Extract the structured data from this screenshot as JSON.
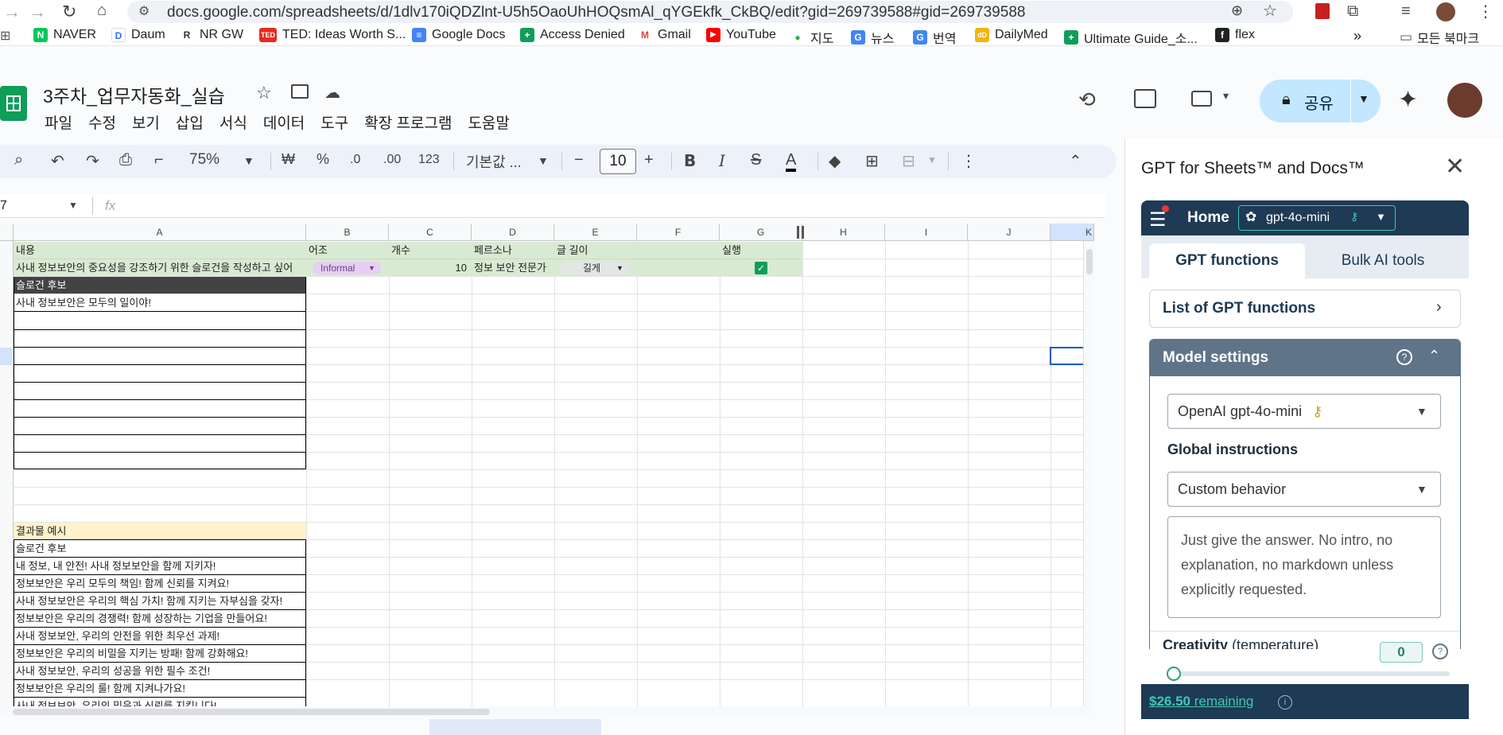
{
  "browser": {
    "url": "docs.google.com/spreadsheets/d/1dlv170iQDZlnt-U5h5OaoUhHOQsmAl_qYGEkfk_CkBQ/edit?gid=269739588#gid=269739588",
    "bookmarks": [
      "NAVER",
      "Daum",
      "NR GW",
      "TED: Ideas Worth S...",
      "Google Docs",
      "Access Denied",
      "Gmail",
      "YouTube",
      "지도",
      "뉴스",
      "번역",
      "DailyMed",
      "Ultimate Guide_소...",
      "flex"
    ],
    "all_bookmarks": "모든 북마크",
    "bookmark_overflow": "»"
  },
  "sheet": {
    "title": "3주차_업무자동화_실습",
    "menu": [
      "파일",
      "수정",
      "보기",
      "삽입",
      "서식",
      "데이터",
      "도구",
      "확장 프로그램",
      "도움말"
    ],
    "share_label": "공유",
    "toolbar": {
      "zoom": "75%",
      "currency": "₩",
      "percent": "%",
      "dec_minus": ".0",
      "dec_plus": ".00",
      "num_format": "123",
      "font": "기본값 ...",
      "font_size": "10",
      "bold": "B",
      "italic": "I",
      "text_color": "A"
    },
    "name_box": "7",
    "fx": "fx",
    "columns": [
      "A",
      "B",
      "C",
      "D",
      "E",
      "F",
      "G",
      "H",
      "I",
      "J",
      "K"
    ],
    "header_row": {
      "a": "내용",
      "b": "어조",
      "c": "개수",
      "d": "페르소나",
      "e": "글 길이",
      "g": "실행"
    },
    "input_row": {
      "a": "사내 정보보안의 중요성을 강조하기 위한 슬로건을 작성하고 싶어",
      "b": "Informal",
      "c": "10",
      "d": "정보 보안 전문가",
      "e": "길게"
    },
    "slogan_header": "슬로건 후보",
    "slogan_first": "사내 정보보안은 모두의 일이야!",
    "example_header": "결과물 예시",
    "example_subheader": "슬로건 후보",
    "examples": [
      "내 정보, 내 안전! 사내 정보보안을 함께 지키자!",
      "정보보안은 우리 모두의 책임! 함께 신뢰를 지켜요!",
      "사내 정보보안은 우리의 핵심 가치! 함께 지키는 자부심을 갖자!",
      "정보보안은 우리의 경쟁력! 함께 성장하는 기업을 만들어요!",
      "사내 정보보안, 우리의 안전을 위한 최우선 과제!",
      "정보보안은 우리의 비밀을 지키는 방패! 함께 강화해요!",
      "사내 정보보안, 우리의 성공을 위한 필수 조건!",
      "정보보안은 우리의 룰! 함께 지켜나가요!",
      "사내 정보보안, 우리의 믿음과 신뢰를 지킵니다!"
    ]
  },
  "sidebar": {
    "title": "GPT for Sheets™ and Docs™",
    "home": "Home",
    "model_chip": "gpt-4o-mini",
    "tabs": [
      "GPT functions",
      "Bulk AI tools"
    ],
    "list_functions": "List of GPT functions",
    "model_settings": "Model settings",
    "model_select": "OpenAI gpt-4o-mini",
    "global_instructions": "Global instructions",
    "behavior_select": "Custom behavior",
    "instructions_text": "Just give the answer. No intro, no explanation, no markdown unless explicitly requested.",
    "creativity": "Creativity",
    "temperature": "(temperature)",
    "temperature_value": "0",
    "temperature_level": 0,
    "balance": "$26.50",
    "remaining": "remaining"
  },
  "colors": {
    "accent_blue": "#0b57d0",
    "share_bg": "#c2e7ff",
    "green_fill": "#d9ead3",
    "sheets_green": "#0f9d58",
    "yellow_fill": "#fff2cc",
    "gpt_navy": "#1e3a55",
    "informal_chip": "#e6cff2"
  }
}
